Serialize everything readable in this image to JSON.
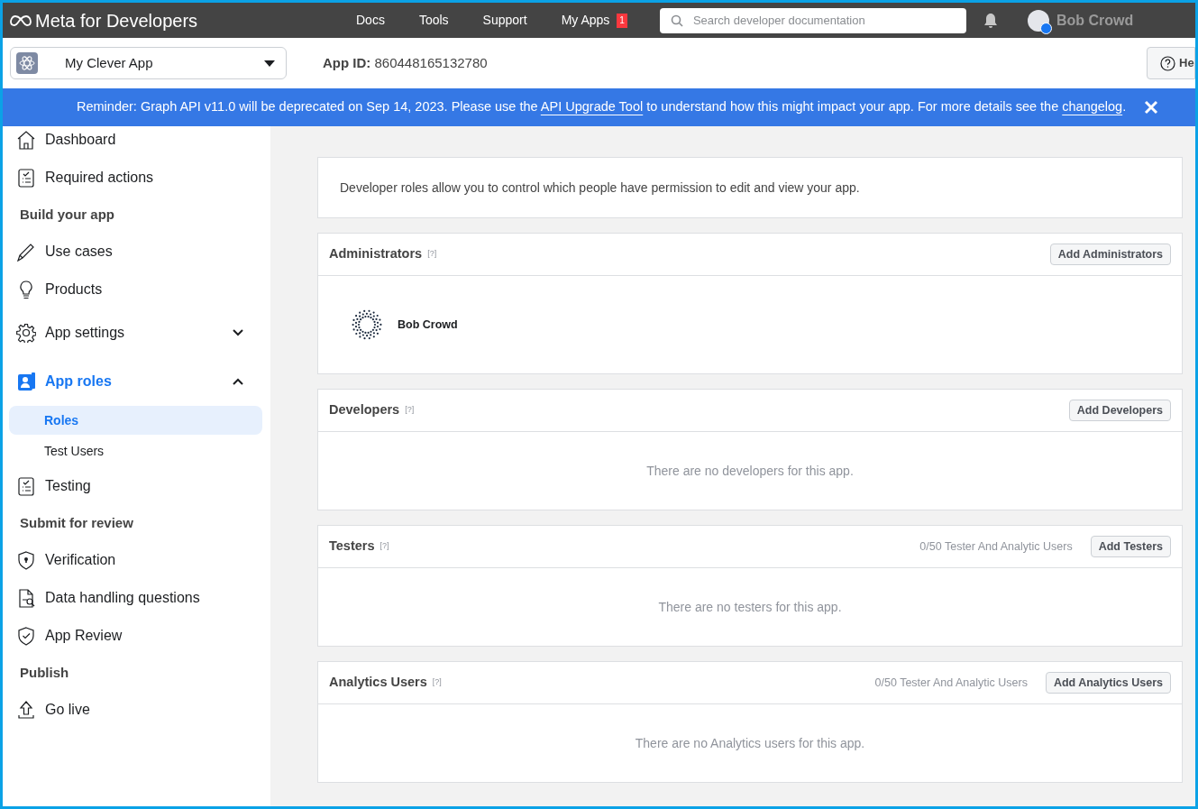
{
  "topbar": {
    "logo": "Meta for Developers",
    "nav": [
      {
        "label": "Docs"
      },
      {
        "label": "Tools"
      },
      {
        "label": "Support"
      },
      {
        "label": "My Apps",
        "badge": "1"
      }
    ],
    "search": {
      "placeholder": "Search developer documentation"
    },
    "user": "Bob Crowd"
  },
  "app_bar": {
    "app_name": "My Clever App",
    "app_id_label": "App ID:",
    "app_id": "860448165132780",
    "help_button": "He"
  },
  "banner": {
    "parts": [
      {
        "kind": "text",
        "text": "Reminder: Graph API v11.0 will be deprecated on Sep 14, 2023. Please use the"
      },
      {
        "kind": "link",
        "text": "API Upgrade Tool"
      },
      {
        "kind": "text",
        "text": "to understand how this might impact your app. For more details see the"
      },
      {
        "kind": "link",
        "text": "changelog"
      },
      {
        "kind": "text",
        "text": "."
      }
    ]
  },
  "sidebar": {
    "items": [
      {
        "kind": "item",
        "label": "Dashboard"
      },
      {
        "kind": "item",
        "label": "Required actions"
      },
      {
        "kind": "heading",
        "label": "Build your app"
      },
      {
        "kind": "item",
        "label": "Use cases"
      },
      {
        "kind": "item",
        "label": "Products"
      },
      {
        "kind": "group",
        "label": "App settings",
        "expanded": false,
        "selected": false
      },
      {
        "kind": "group",
        "label": "App roles",
        "expanded": true,
        "selected": true,
        "children": [
          {
            "label": "Roles",
            "selected": true
          },
          {
            "label": "Test Users",
            "selected": false
          }
        ]
      },
      {
        "kind": "item",
        "label": "Testing"
      },
      {
        "kind": "heading",
        "label": "Submit for review"
      },
      {
        "kind": "item",
        "label": "Verification"
      },
      {
        "kind": "item",
        "label": "Data handling questions"
      },
      {
        "kind": "item",
        "label": "App Review"
      },
      {
        "kind": "heading",
        "label": "Publish"
      },
      {
        "kind": "item",
        "label": "Go live"
      }
    ]
  },
  "main": {
    "intro": "Developer roles allow you to control which people have permission to edit and view your app.",
    "sections": [
      {
        "title": "Administrators",
        "help": "[?]",
        "button": "Add Administrators",
        "members": [
          {
            "name": "Bob Crowd"
          }
        ]
      },
      {
        "title": "Developers",
        "help": "[?]",
        "button": "Add Developers",
        "empty_text": "There are no developers for this app."
      },
      {
        "title": "Testers",
        "help": "[?]",
        "count": "0/50 Tester And Analytic Users",
        "button": "Add Testers",
        "empty_text": "There are no testers for this app."
      },
      {
        "title": "Analytics Users",
        "help": "[?]",
        "count": "0/50 Tester And Analytic Users",
        "button": "Add Analytics Users",
        "empty_text": "There are no Analytics users for this app."
      }
    ]
  }
}
